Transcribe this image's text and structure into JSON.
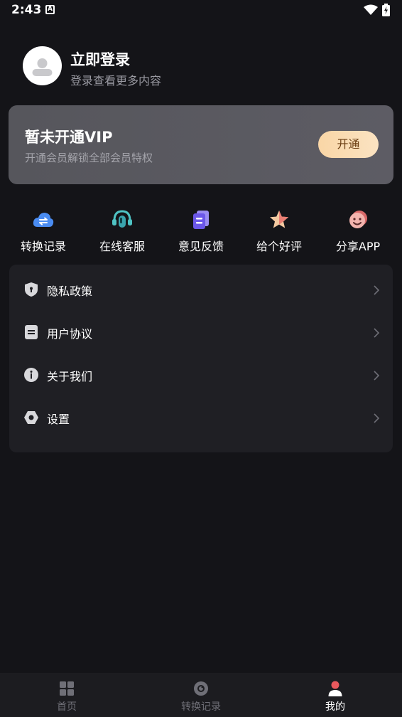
{
  "status_bar": {
    "time": "2:43",
    "indicator": "A"
  },
  "profile": {
    "title": "立即登录",
    "subtitle": "登录查看更多内容"
  },
  "vip": {
    "title": "暂未开通VIP",
    "subtitle": "开通会员解锁全部会员特权",
    "button": "开通"
  },
  "quick_actions": [
    {
      "label": "转换记录",
      "icon": "cloud-convert-icon"
    },
    {
      "label": "在线客服",
      "icon": "headset-icon"
    },
    {
      "label": "意见反馈",
      "icon": "feedback-icon"
    },
    {
      "label": "给个好评",
      "icon": "star-icon"
    },
    {
      "label": "分享APP",
      "icon": "smile-icon"
    }
  ],
  "menu": [
    {
      "label": "隐私政策",
      "icon": "shield-icon"
    },
    {
      "label": "用户协议",
      "icon": "document-icon"
    },
    {
      "label": "关于我们",
      "icon": "info-icon"
    },
    {
      "label": "设置",
      "icon": "settings-icon"
    }
  ],
  "bottom_nav": [
    {
      "label": "首页",
      "icon": "grid-icon",
      "active": false
    },
    {
      "label": "转换记录",
      "icon": "record-icon",
      "active": false
    },
    {
      "label": "我的",
      "icon": "user-icon",
      "active": true
    }
  ],
  "colors": {
    "background": "#141418",
    "card": "#1f1f24",
    "vip_button": "#f9d6a6",
    "active_user_icon": "#e9585d"
  }
}
